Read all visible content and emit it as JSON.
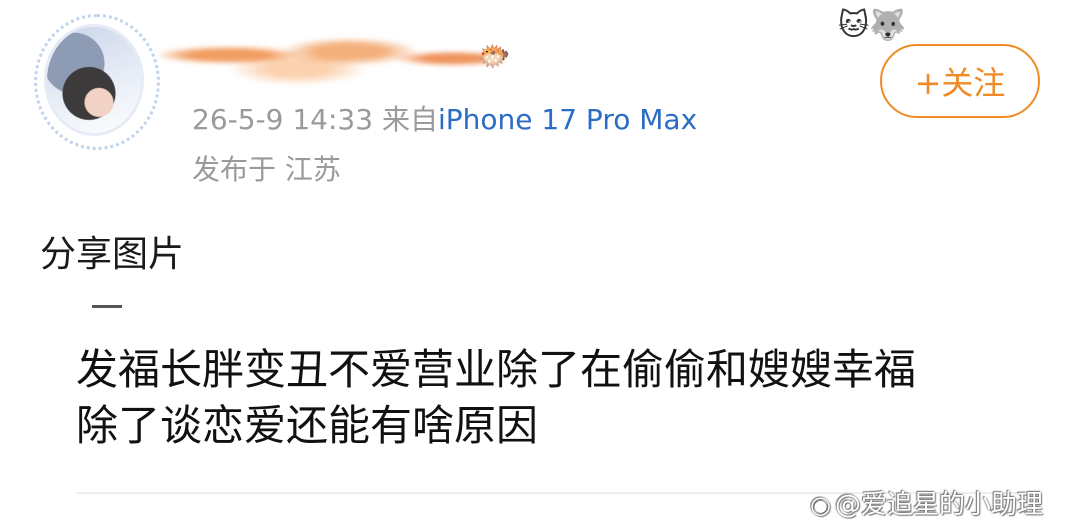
{
  "post": {
    "timestamp": "26-5-9 14:33",
    "source_prefix": "来自",
    "source_device": "iPhone 17 Pro Max",
    "location": "发布于 江苏",
    "text": "分享图片"
  },
  "follow_button": {
    "label": "+关注"
  },
  "shared_image": {
    "line1": "发福长胖变丑不爱营业除了在偷偷和嫂嫂幸福",
    "line2": "除了谈恋爱还能有啥原因"
  },
  "watermark": {
    "text": "@爱追星的小助理"
  },
  "icons": {
    "fish": "🐡",
    "decoration": "🐱🐺",
    "weibo": "◉"
  },
  "colors": {
    "accent": "#f08a24",
    "link": "#2b6cc4",
    "muted": "#9a9a9a"
  }
}
